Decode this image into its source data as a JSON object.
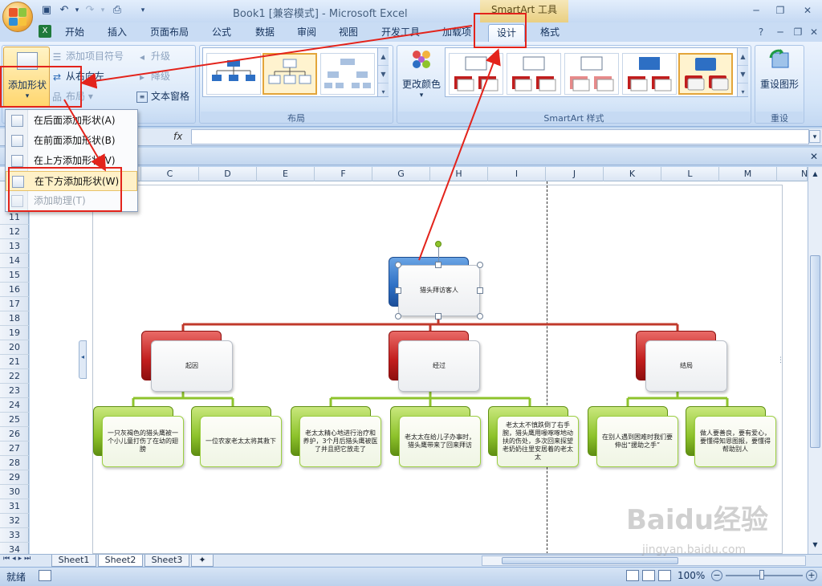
{
  "window": {
    "title": "Book1  [兼容模式] - Microsoft Excel",
    "context_title": "SmartArt 工具"
  },
  "tabs": [
    "开始",
    "插入",
    "页面布局",
    "公式",
    "数据",
    "审阅",
    "视图",
    "开发工具",
    "加载项",
    "设计",
    "格式"
  ],
  "active_tab": "设计",
  "ribbon": {
    "create_graphic": {
      "add_shape_label": "添加形状",
      "add_bullet": "添加项目符号",
      "right_to_left": "从右向左",
      "layout_btn": "布局",
      "promote": "升级",
      "demote": "降级",
      "text_pane": "文本窗格"
    },
    "layout_group_label": "布局",
    "change_colors": "更改颜色",
    "styles_group_label": "SmartArt 样式",
    "reset_graphic": "重设图形",
    "reset_group_label": "重设"
  },
  "dropdown": {
    "items": [
      {
        "label": "在后面添加形状(A)",
        "enabled": true
      },
      {
        "label": "在前面添加形状(B)",
        "enabled": true
      },
      {
        "label": "在上方添加形状(V)",
        "enabled": true
      },
      {
        "label": "在下方添加形状(W)",
        "enabled": true
      },
      {
        "label": "添加助理(T)",
        "enabled": false
      }
    ]
  },
  "formula_bar": {
    "fx": "fx",
    "value": ""
  },
  "columns": [
    "C",
    "D",
    "E",
    "F",
    "G",
    "H",
    "I",
    "J",
    "K",
    "L",
    "M",
    "N"
  ],
  "rows": [
    "11",
    "12",
    "13",
    "14",
    "15",
    "16",
    "17",
    "18",
    "19",
    "20",
    "21",
    "22",
    "23",
    "24",
    "25",
    "26",
    "27",
    "28",
    "29",
    "30",
    "31",
    "32",
    "33",
    "34"
  ],
  "smartart": {
    "root": "猎头拜访客人",
    "level2": [
      "起因",
      "经过",
      "结局"
    ],
    "level3": [
      "一只灰褐色的猎头鹰被一个小儿童打伤了在幼的翅膀",
      "一位农家老太太将其救下",
      "老太太精心地进行治疗和养护，3个月后猎头鹰被医了并且把它放走了",
      "老太太在给儿子办事时，猎头鹰带来了回来拜访",
      "老太太不慎跌倒了右手腕，猎头鹰用喙啄啄地动扶的伤处，多次回来探望老奶奶往里安居着的老太太",
      "在别人遇到困难时我们要伸出“援助之手”",
      "做人要善良，要有爱心，要懂得知恩图报，要懂得帮助别人"
    ],
    "colors": {
      "root": "#2d6fc4",
      "level2": "#c11d1d",
      "level3": "#8ec32c",
      "connector_top": "#c0392b",
      "connector_bottom": "#8ec32c"
    }
  },
  "sheets": [
    "Sheet1",
    "Sheet2",
    "Sheet3"
  ],
  "active_sheet": "Sheet2",
  "status": {
    "ready": "就绪",
    "zoom": "100%"
  },
  "watermark": {
    "main": "Baidu经验",
    "sub": "jingyan.baidu.com"
  },
  "accent": "#e3231b"
}
